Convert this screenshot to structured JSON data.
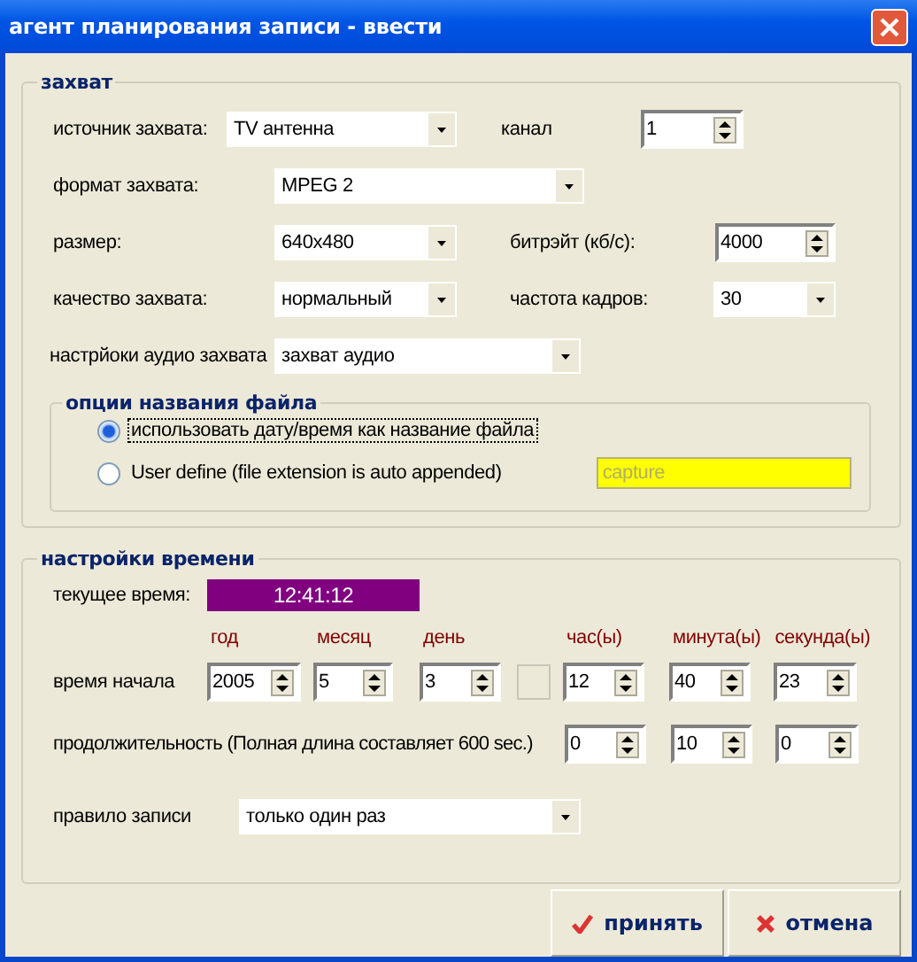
{
  "window": {
    "title": "агент планирования записи - ввести"
  },
  "capture": {
    "title": "захват",
    "source": {
      "label": "источник захвата:",
      "value": "TV антенна"
    },
    "channel": {
      "label": "канал",
      "value": "1"
    },
    "format": {
      "label": "формат захвата:",
      "value": "MPEG 2"
    },
    "size": {
      "label": "размер:",
      "value": "640x480"
    },
    "bitrate": {
      "label": "битрэйт (кб/с):",
      "value": "4000"
    },
    "quality": {
      "label": "качество захвата:",
      "value": "нормальный"
    },
    "framerate": {
      "label": "частота кадров:",
      "value": "30"
    },
    "audio": {
      "label": "настрйоки аудио захвата",
      "value": "захват аудио"
    }
  },
  "filename_options": {
    "title": "опции названия файла",
    "options": [
      {
        "label": "использовать дату/время как название файла",
        "selected": true
      },
      {
        "label": "User define (file extension is auto appended)",
        "selected": false
      }
    ],
    "custom_name": {
      "value": "capture",
      "disabled": true
    }
  },
  "time_settings": {
    "title": "настройки времени",
    "current_time": {
      "label": "текущее время:",
      "value": "12:41:12"
    },
    "column_headers": [
      "год",
      "месяц",
      "день",
      "час(ы)",
      "минута(ы)",
      "секунда(ы)"
    ],
    "start": {
      "label": "время начала",
      "date": [
        "2005",
        "5",
        "3"
      ],
      "time": [
        "12",
        "40",
        "23"
      ]
    },
    "duration": {
      "label": "продолжительность (Полная длина составляет 600 sec.)",
      "values": [
        "0",
        "10",
        "0"
      ]
    },
    "rule": {
      "label": "правило записи",
      "value": "только один раз"
    }
  },
  "buttons": [
    {
      "label": "принять",
      "kind": "accept"
    },
    {
      "label": "отмена",
      "kind": "cancel"
    }
  ]
}
